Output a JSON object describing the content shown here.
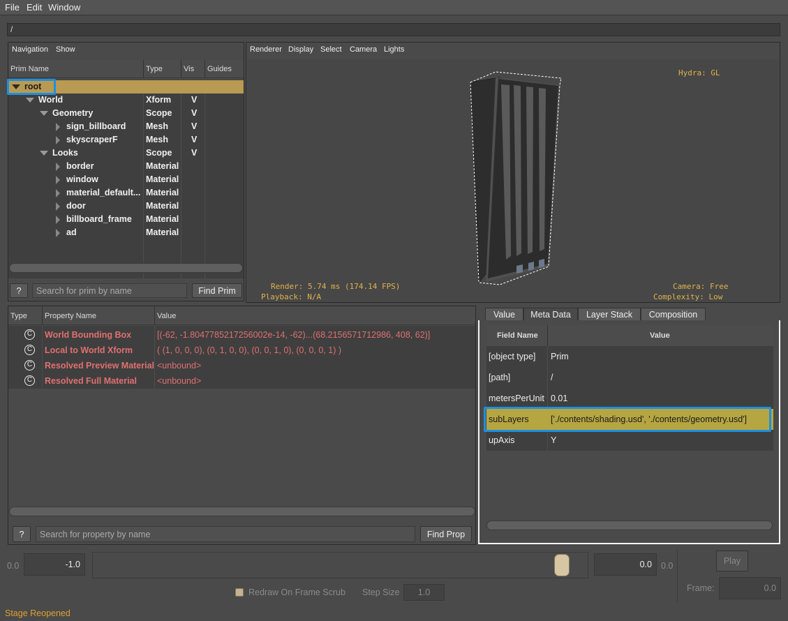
{
  "menu": {
    "file": "File",
    "edit": "Edit",
    "window": "Window"
  },
  "path": "/",
  "prim_panel": {
    "tabs": {
      "navigation": "Navigation",
      "show": "Show"
    },
    "columns": {
      "name": "Prim Name",
      "type": "Type",
      "vis": "Vis",
      "guides": "Guides"
    },
    "rows": [
      {
        "name": "root",
        "type": "",
        "vis": ""
      },
      {
        "name": "World",
        "type": "Xform",
        "vis": "V"
      },
      {
        "name": "Geometry",
        "type": "Scope",
        "vis": "V"
      },
      {
        "name": "sign_billboard",
        "type": "Mesh",
        "vis": "V"
      },
      {
        "name": "skyscraperF",
        "type": "Mesh",
        "vis": "V"
      },
      {
        "name": "Looks",
        "type": "Scope",
        "vis": "V"
      },
      {
        "name": "border",
        "type": "Material",
        "vis": ""
      },
      {
        "name": "window",
        "type": "Material",
        "vis": ""
      },
      {
        "name": "material_default...",
        "type": "Material",
        "vis": ""
      },
      {
        "name": "door",
        "type": "Material",
        "vis": ""
      },
      {
        "name": "billboard_frame",
        "type": "Material",
        "vis": ""
      },
      {
        "name": "ad",
        "type": "Material",
        "vis": ""
      }
    ],
    "help_label": "?",
    "search_placeholder": "Search for prim by name",
    "find_label": "Find Prim"
  },
  "viewport": {
    "menus": {
      "renderer": "Renderer",
      "display": "Display",
      "select": "Select",
      "camera": "Camera",
      "lights": "Lights"
    },
    "hud": {
      "hydra": "Hydra: GL",
      "render": "Render: 5.74 ms (174.14 FPS)",
      "playback": "Playback: N/A",
      "camera": "Camera: Free",
      "complexity": "Complexity: Low"
    }
  },
  "property_panel": {
    "columns": {
      "type": "Type",
      "name": "Property Name",
      "value": "Value"
    },
    "rows": [
      {
        "icon": "C",
        "name": "World Bounding Box",
        "value": "[(-62, -1.8047785217256002e-14, -62)...(68.2156571712986, 408, 62)]"
      },
      {
        "icon": "C",
        "name": "Local to World Xform",
        "value": "( (1, 0, 0, 0), (0, 1, 0, 0), (0, 0, 1, 0), (0, 0, 0, 1) )"
      },
      {
        "icon": "C",
        "name": "Resolved Preview Material",
        "value": "<unbound>"
      },
      {
        "icon": "C",
        "name": "Resolved Full Material",
        "value": "<unbound>"
      }
    ],
    "help_label": "?",
    "search_placeholder": "Search for property by name",
    "find_label": "Find Prop"
  },
  "meta_panel": {
    "tabs": {
      "value": "Value",
      "meta": "Meta Data",
      "layer": "Layer Stack",
      "composition": "Composition"
    },
    "columns": {
      "field": "Field Name",
      "value": "Value"
    },
    "rows": [
      {
        "field": "[object type]",
        "value": "Prim"
      },
      {
        "field": "[path]",
        "value": "/"
      },
      {
        "field": "metersPerUnit",
        "value": "0.01"
      },
      {
        "field": "subLayers",
        "value": "['./contents/shading.usd', './contents/geometry.usd']"
      },
      {
        "field": "upAxis",
        "value": "Y"
      }
    ]
  },
  "timeline": {
    "range_start": "0.0",
    "start_value": "-1.0",
    "end_value": "0.0",
    "range_end": "0.0",
    "play_label": "Play",
    "redraw_label": "Redraw On Frame Scrub",
    "step_label": "Step Size",
    "step_value": "1.0",
    "frame_label": "Frame:",
    "frame_value": "0.0",
    "slider_position": 1.0
  },
  "status": "Stage Reopened",
  "colors": {
    "accent": "#1e90e0",
    "selected_row": "#b99a52",
    "highlight_row": "#b5a642",
    "warning_text": "#e07070",
    "status_text": "#e0a030"
  }
}
